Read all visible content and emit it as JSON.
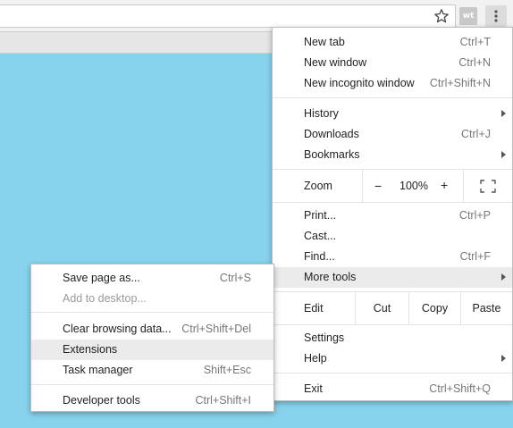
{
  "toolbar": {
    "extension_badge": "wt",
    "star_icon": "bookmark-star-icon",
    "menu_icon": "three-dot-menu-icon"
  },
  "page": {
    "background": "#87d3ee"
  },
  "main_menu": {
    "new_tab": {
      "label": "New tab",
      "accel": "Ctrl+T"
    },
    "new_window": {
      "label": "New window",
      "accel": "Ctrl+N"
    },
    "new_incognito": {
      "label": "New incognito window",
      "accel": "Ctrl+Shift+N"
    },
    "history": {
      "label": "History"
    },
    "downloads": {
      "label": "Downloads",
      "accel": "Ctrl+J"
    },
    "bookmarks": {
      "label": "Bookmarks"
    },
    "zoom": {
      "label": "Zoom",
      "minus": "−",
      "value": "100%",
      "plus": "+"
    },
    "print": {
      "label": "Print...",
      "accel": "Ctrl+P"
    },
    "cast": {
      "label": "Cast..."
    },
    "find": {
      "label": "Find...",
      "accel": "Ctrl+F"
    },
    "more_tools": {
      "label": "More tools"
    },
    "edit": {
      "label": "Edit",
      "cut": "Cut",
      "copy": "Copy",
      "paste": "Paste"
    },
    "settings": {
      "label": "Settings"
    },
    "help": {
      "label": "Help"
    },
    "exit": {
      "label": "Exit",
      "accel": "Ctrl+Shift+Q"
    }
  },
  "more_tools_menu": {
    "save_page": {
      "label": "Save page as...",
      "accel": "Ctrl+S"
    },
    "add_to_desktop": {
      "label": "Add to desktop..."
    },
    "clear_browsing": {
      "label": "Clear browsing data...",
      "accel": "Ctrl+Shift+Del"
    },
    "extensions": {
      "label": "Extensions"
    },
    "task_manager": {
      "label": "Task manager",
      "accel": "Shift+Esc"
    },
    "developer_tools": {
      "label": "Developer tools",
      "accel": "Ctrl+Shift+I"
    }
  }
}
